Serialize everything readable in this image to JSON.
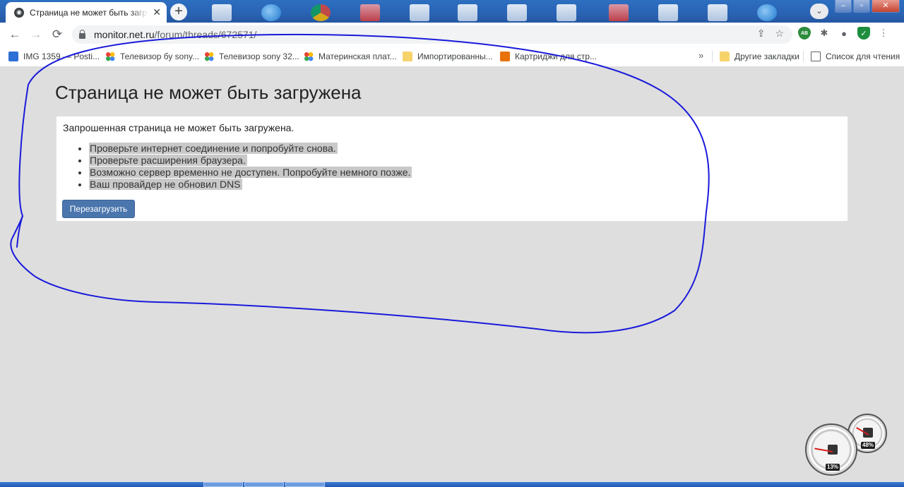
{
  "tab": {
    "title": "Страница не может быть загружена",
    "close_label": "✕",
    "new_tab_label": "+"
  },
  "window": {
    "tab_search_label": "⌄",
    "minimize_label": "–",
    "maximize_label": "▫",
    "close_label": "✕"
  },
  "toolbar": {
    "back_icon": "←",
    "forward_icon": "→",
    "reload_icon": "⟳",
    "url_host": "monitor.net.ru",
    "url_path": "/forum/threads/672571/",
    "share_icon": "⇪",
    "bookmark_star_icon": "☆",
    "extensions": {
      "adblock_label": "AB",
      "puzzle_icon": "✱",
      "profile_icon": "●",
      "shield_icon": "✓",
      "menu_icon": "⋮"
    }
  },
  "bookmarks": {
    "items": [
      {
        "label": "IMG 1359 — Posti..."
      },
      {
        "label": "Телевизор бу sony..."
      },
      {
        "label": "Телевизор sony 32..."
      },
      {
        "label": "Материнская плат..."
      },
      {
        "label": "Импортированны..."
      },
      {
        "label": "Картриджи для стр..."
      }
    ],
    "more_icon": "»",
    "other_label": "Другие закладки",
    "reading_list_label": "Список для чтения"
  },
  "page": {
    "title": "Страница не может быть загружена",
    "intro": "Запрошенная страница не может быть загружена.",
    "reasons": [
      "Проверьте интернет соединение и попробуйте снова.",
      "Проверьте расширения браузера.",
      "Возможно сервер временно не доступен. Попробуйте немного позже.",
      "Ваш провайдер не обновил DNS"
    ],
    "reload_button": "Перезагрузить"
  },
  "gadgets": {
    "cpu_percent": "13%",
    "memory_percent": "48%"
  },
  "colors": {
    "page_background": "#dedede",
    "button_blue": "#4a76ad",
    "highlight_gray": "#c9c9c9",
    "annotation_blue": "#1a1adb"
  }
}
